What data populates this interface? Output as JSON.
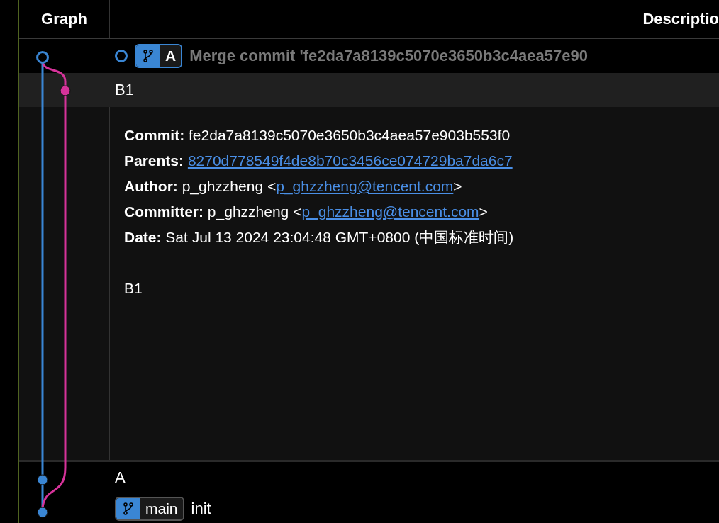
{
  "columns": [
    "Graph",
    "Descriptio"
  ],
  "commits": [
    {
      "message": "Merge commit 'fe2da7a8139c5070e3650b3c4aea57e90",
      "dimmed": true,
      "selected": false,
      "head": true,
      "refs": [
        {
          "name": "A",
          "current": true
        }
      ]
    },
    {
      "message": "B1",
      "dimmed": false,
      "selected": true,
      "head": false
    }
  ],
  "details": {
    "fields": [
      {
        "label": "Commit:",
        "kind": "plain",
        "value": "fe2da7a8139c5070e3650b3c4aea57e903b553f0"
      },
      {
        "label": "Parents:",
        "kind": "link",
        "value": "8270d778549f4de8b70c3456ce074729ba7da6c7"
      },
      {
        "label": "Author:",
        "kind": "email",
        "value": "p_ghzzheng <",
        "email": "p_ghzzheng@tencent.com",
        "suffix": ">"
      },
      {
        "label": "Committer:",
        "kind": "email",
        "value": "p_ghzzheng <",
        "email": "p_ghzzheng@tencent.com",
        "suffix": ">"
      },
      {
        "label": "Date:",
        "kind": "plain",
        "value": "Sat Jul 13 2024 23:04:48 GMT+0800 (中国标准时间)"
      }
    ],
    "body": "B1"
  },
  "later_commits": [
    {
      "message": "A",
      "dimmed": false,
      "selected": false
    },
    {
      "message": "init",
      "dimmed": false,
      "selected": false,
      "refs": [
        {
          "name": "main",
          "current": false
        }
      ]
    }
  ]
}
